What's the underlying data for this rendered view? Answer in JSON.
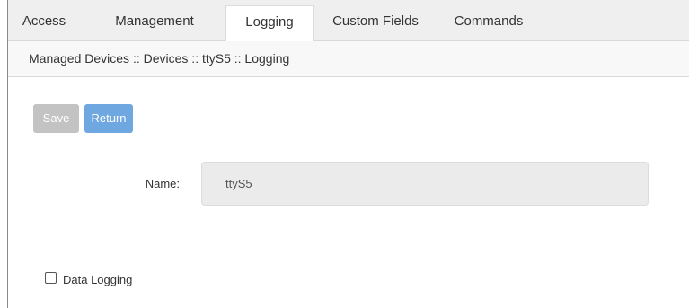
{
  "tabs": [
    {
      "label": "Access",
      "active": false
    },
    {
      "label": "Management",
      "active": false
    },
    {
      "label": "Logging",
      "active": true
    },
    {
      "label": "Custom Fields",
      "active": false
    },
    {
      "label": "Commands",
      "active": false
    }
  ],
  "breadcrumb": "Managed Devices :: Devices :: ttyS5 :: Logging",
  "buttons": {
    "save_label": "Save",
    "return_label": "Return"
  },
  "form": {
    "name_label": "Name:",
    "name_value": "ttyS5"
  },
  "data_logging": {
    "label": "Data Logging",
    "checked": false
  },
  "colors": {
    "tabbar_bg": "#efefef",
    "save_disabled": "#c3c3c3",
    "return_blue": "#6fa7e0",
    "input_bg": "#ebebeb"
  }
}
